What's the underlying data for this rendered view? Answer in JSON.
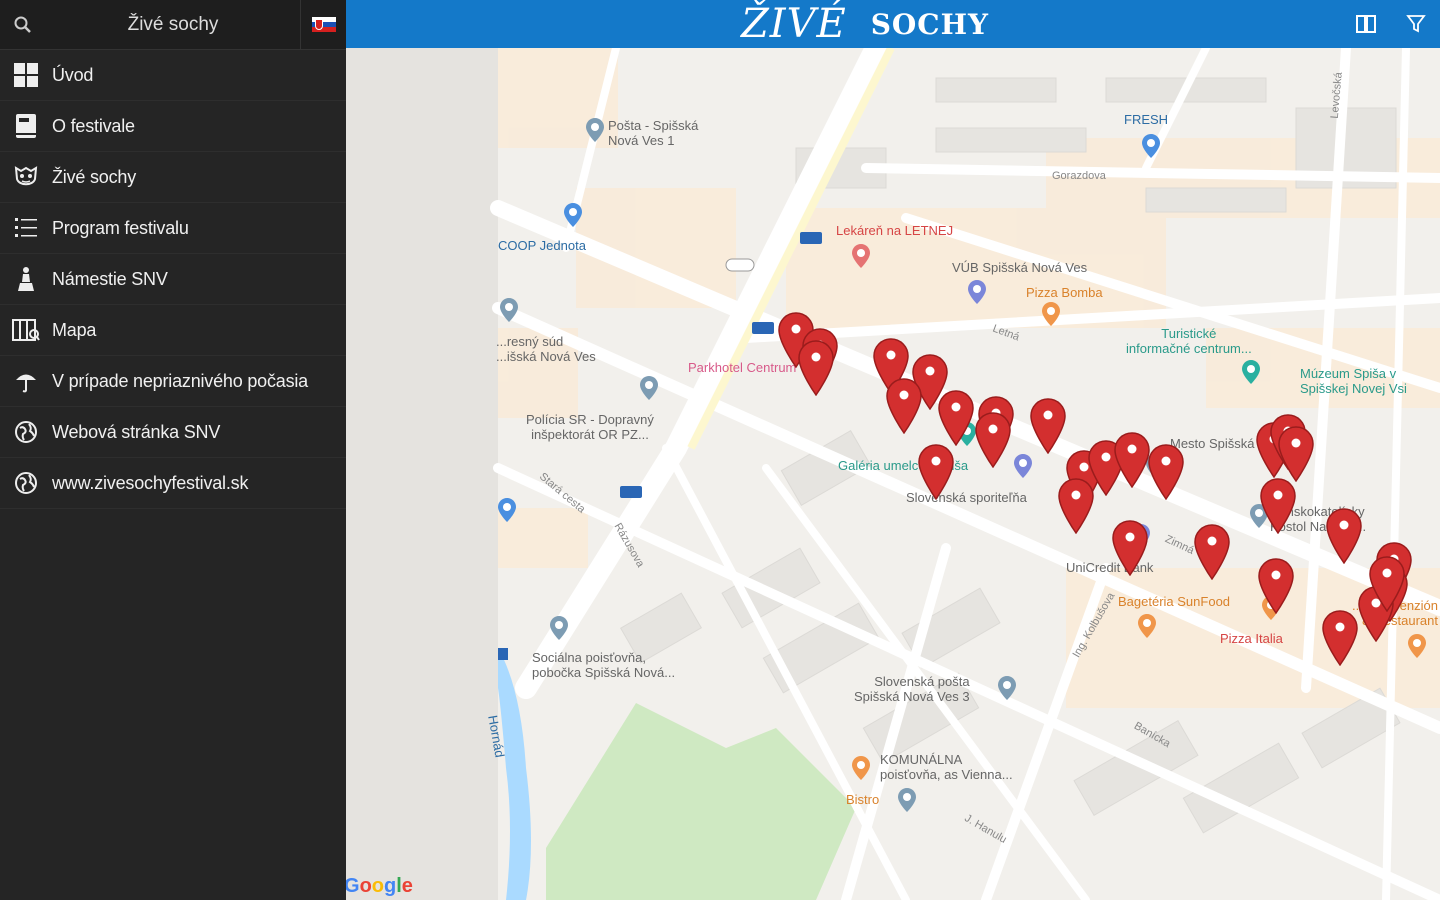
{
  "app": {
    "sidebar_title": "Živé sochy",
    "logo_part1": "ŽIVÉ",
    "logo_part2": "SOCHY",
    "accent_color": "#1479c9"
  },
  "sidebar": {
    "items": [
      {
        "label": "Úvod",
        "icon": "grid-icon"
      },
      {
        "label": "O festivale",
        "icon": "book-icon"
      },
      {
        "label": "Živé sochy",
        "icon": "mask-icon"
      },
      {
        "label": "Program festivalu",
        "icon": "list-icon"
      },
      {
        "label": "Námestie SNV",
        "icon": "monument-icon"
      },
      {
        "label": "Mapa",
        "icon": "map-icon"
      },
      {
        "label": "V prípade nepriaznivého počasia",
        "icon": "umbrella-icon"
      },
      {
        "label": "Webová stránka SNV",
        "icon": "globe-icon"
      },
      {
        "label": "www.zivesochyfestival.sk",
        "icon": "globe-icon"
      }
    ]
  },
  "map": {
    "labels": {
      "posta": "Pošta - Spišská\nNová Ves 1",
      "fresh": "FRESH",
      "coop": "COOP Jednota",
      "lekaren": "Lekáreň na LETNEJ",
      "vub": "VÚB Spišská Nová Ves",
      "pizza_bomba": "Pizza Bomba",
      "turisticke": "Turistické\ninformačné centrum...",
      "muzeum": "Múzeum Spiša v\nSpišskej Novej Vsi",
      "sud": "...resný súd\n...išská Nová Ves",
      "parkhotel": "Parkhotel Centrum",
      "policia": "Polícia SR - Dopravný\ninšpektorát OR PZ...",
      "galeria": "Galéria umelcov Spiša",
      "sporitelna": "Slovenská sporiteľňa",
      "mesto": "Mesto Spišská No...",
      "kostol": "Rímskokatolícky\nKostol Nanebo...",
      "unicredit": "UniCredit Bank",
      "bageteria": "Bagetéria SunFood",
      "pizza_italia": "Pizza Italia",
      "penzion": "...ilbar Penzión\n& Restaurant",
      "socialna": "Sociálna poisťovňa,\npobočka Spišská Nová...",
      "slovenska_posta": "Slovenská pošta\nSpišská Nová Ves 3",
      "komunalna": "KOMUNÁLNA\npoisťovňa, as Vienna...",
      "bistro": "Bistro",
      "hornad": "Hornád",
      "letna": "Letná",
      "zimna": "Zimná",
      "gorazdova": "Gorazdova",
      "razusova": "Rázusova",
      "stara_cesta": "Stará cesta",
      "banicka": "Banícka",
      "hanulu": "J. Hanulu",
      "levocska": "Levočská",
      "ul_kolbusova": "Ing. Kolbušova"
    },
    "attribution": [
      "G",
      "o",
      "o",
      "g",
      "l",
      "e"
    ],
    "pin_count": 29,
    "pin_color": "#d32f2f"
  }
}
